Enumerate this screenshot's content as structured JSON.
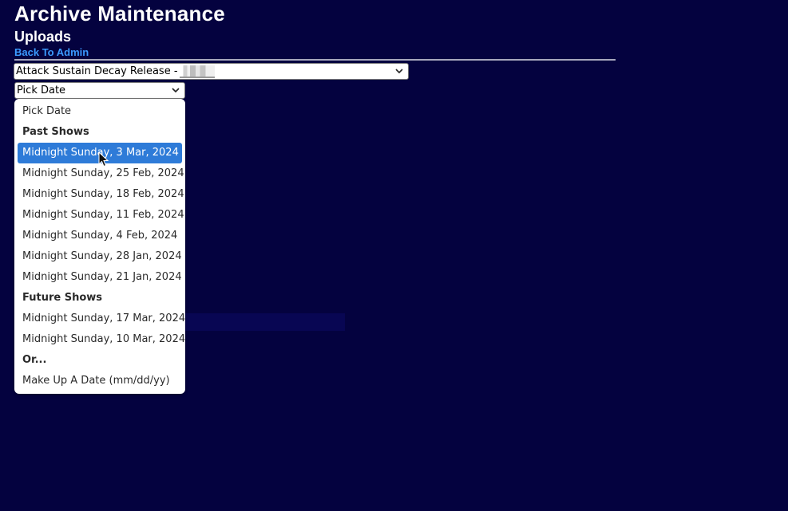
{
  "page": {
    "title": "Archive Maintenance",
    "subtitle": "Uploads",
    "back_link": "Back To Admin"
  },
  "show_select": {
    "value": "Attack Sustain Decay Release -"
  },
  "date_select": {
    "value": "Pick Date"
  },
  "dropdown": {
    "placeholder": "Pick Date",
    "past_label": "Past Shows",
    "past": [
      "Midnight Sunday, 3 Mar, 2024",
      "Midnight Sunday, 25 Feb, 2024",
      "Midnight Sunday, 18 Feb, 2024",
      "Midnight Sunday, 11 Feb, 2024",
      "Midnight Sunday, 4 Feb, 2024",
      "Midnight Sunday, 28 Jan, 2024",
      "Midnight Sunday, 21 Jan, 2024"
    ],
    "future_label": "Future Shows",
    "future": [
      "Midnight Sunday, 17 Mar, 2024",
      "Midnight Sunday, 10 Mar, 2024"
    ],
    "or_label": "Or...",
    "custom": "Make Up A Date (mm/dd/yy)",
    "highlighted": "Midnight Sunday, 3 Mar, 2024"
  },
  "colors": {
    "background": "#04023f",
    "link": "#3b9bff",
    "highlight": "#2e7bd8"
  },
  "icons": {
    "select_arrow": "chevron-down-icon",
    "pointer": "mouse-pointer-icon"
  }
}
